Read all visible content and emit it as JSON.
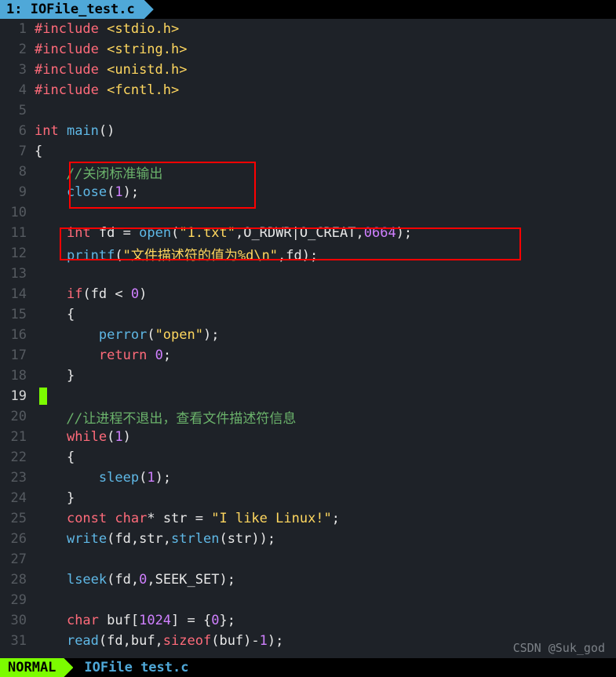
{
  "tab": {
    "label": "1: IOFile_test.c"
  },
  "status": {
    "mode": "NORMAL",
    "file": "IOFile test.c"
  },
  "watermark": "CSDN @Suk_god",
  "cursor_line": 19,
  "code": {
    "l1": {
      "pp": "#include",
      "hdr": " <stdio.h>"
    },
    "l2": {
      "pp": "#include",
      "hdr": " <string.h>"
    },
    "l3": {
      "pp": "#include",
      "hdr": " <unistd.h>"
    },
    "l4": {
      "pp": "#include",
      "hdr": " <fcntl.h>"
    },
    "l6": {
      "kw": "int",
      "fn": " main",
      "rest": "()"
    },
    "l7": {
      "txt": "{"
    },
    "l8": {
      "indent": "    ",
      "comment": "//",
      "cjk": "关闭标准输出"
    },
    "l9": {
      "indent": "    ",
      "fn": "close",
      "p1": "(",
      "n": "1",
      "p2": ");"
    },
    "l11": {
      "indent": "    ",
      "kw": "int",
      "id": " fd ",
      "op": "= ",
      "fn": "open",
      "p1": "(",
      "s": "\"1.txt\"",
      "c1": ",O_RDWR|O_CREAT,",
      "n": "0664",
      "p2": ");"
    },
    "l12": {
      "indent": "    ",
      "fn": "printf",
      "p1": "(",
      "s": "\"文件描述符的值为%d\\n\"",
      "c1": ",fd);"
    },
    "l14": {
      "indent": "    ",
      "kw": "if",
      "rest": "(fd < ",
      "n": "0",
      "p2": ")"
    },
    "l15": {
      "indent": "    ",
      "txt": "{"
    },
    "l16": {
      "indent": "        ",
      "fn": "perror",
      "p1": "(",
      "s": "\"open\"",
      "p2": ");"
    },
    "l17": {
      "indent": "        ",
      "kw": "return",
      "sp": " ",
      "n": "0",
      "p2": ";"
    },
    "l18": {
      "indent": "    ",
      "txt": "}"
    },
    "l20": {
      "indent": "    ",
      "comment": "//",
      "cjk": "让进程不退出，查看文件描述符信息"
    },
    "l21": {
      "indent": "    ",
      "kw": "while",
      "p1": "(",
      "n": "1",
      "p2": ")"
    },
    "l22": {
      "indent": "    ",
      "txt": "{"
    },
    "l23": {
      "indent": "        ",
      "fn": "sleep",
      "p1": "(",
      "n": "1",
      "p2": ");"
    },
    "l24": {
      "indent": "    ",
      "txt": "}"
    },
    "l25": {
      "indent": "    ",
      "kw1": "const",
      "kw2": " char",
      "op": "* ",
      "id": "str ",
      "eq": "= ",
      "s": "\"I like Linux!\"",
      "p2": ";"
    },
    "l26": {
      "indent": "    ",
      "fn": "write",
      "p1": "(fd,str,",
      "fn2": "strlen",
      "p2": "(str));"
    },
    "l28": {
      "indent": "    ",
      "fn": "lseek",
      "p1": "(fd,",
      "n": "0",
      "c1": ",SEEK_SET);"
    },
    "l30": {
      "indent": "    ",
      "kw": "char",
      "id": " buf[",
      "n": "1024",
      "mid": "] = {",
      "n2": "0",
      "p2": "};"
    },
    "l31": {
      "indent": "    ",
      "fn": "read",
      "p1": "(fd,buf,",
      "sz": "sizeof",
      "p2": "(buf)-",
      "n": "1",
      "p3": ");"
    }
  },
  "lines": [
    1,
    2,
    3,
    4,
    5,
    6,
    7,
    8,
    9,
    10,
    11,
    12,
    13,
    14,
    15,
    16,
    17,
    18,
    19,
    20,
    21,
    22,
    23,
    24,
    25,
    26,
    27,
    28,
    29,
    30,
    31
  ]
}
